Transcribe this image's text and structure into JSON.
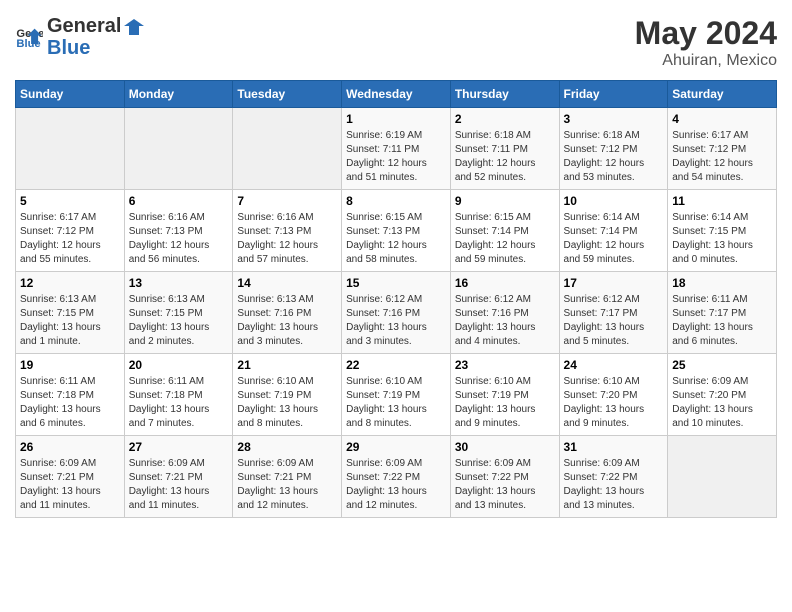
{
  "header": {
    "logo_general": "General",
    "logo_blue": "Blue",
    "title": "May 2024",
    "subtitle": "Ahuiran, Mexico"
  },
  "weekdays": [
    "Sunday",
    "Monday",
    "Tuesday",
    "Wednesday",
    "Thursday",
    "Friday",
    "Saturday"
  ],
  "weeks": [
    [
      {
        "day": "",
        "sunrise": "",
        "sunset": "",
        "daylight": ""
      },
      {
        "day": "",
        "sunrise": "",
        "sunset": "",
        "daylight": ""
      },
      {
        "day": "",
        "sunrise": "",
        "sunset": "",
        "daylight": ""
      },
      {
        "day": "1",
        "sunrise": "Sunrise: 6:19 AM",
        "sunset": "Sunset: 7:11 PM",
        "daylight": "Daylight: 12 hours and 51 minutes."
      },
      {
        "day": "2",
        "sunrise": "Sunrise: 6:18 AM",
        "sunset": "Sunset: 7:11 PM",
        "daylight": "Daylight: 12 hours and 52 minutes."
      },
      {
        "day": "3",
        "sunrise": "Sunrise: 6:18 AM",
        "sunset": "Sunset: 7:12 PM",
        "daylight": "Daylight: 12 hours and 53 minutes."
      },
      {
        "day": "4",
        "sunrise": "Sunrise: 6:17 AM",
        "sunset": "Sunset: 7:12 PM",
        "daylight": "Daylight: 12 hours and 54 minutes."
      }
    ],
    [
      {
        "day": "5",
        "sunrise": "Sunrise: 6:17 AM",
        "sunset": "Sunset: 7:12 PM",
        "daylight": "Daylight: 12 hours and 55 minutes."
      },
      {
        "day": "6",
        "sunrise": "Sunrise: 6:16 AM",
        "sunset": "Sunset: 7:13 PM",
        "daylight": "Daylight: 12 hours and 56 minutes."
      },
      {
        "day": "7",
        "sunrise": "Sunrise: 6:16 AM",
        "sunset": "Sunset: 7:13 PM",
        "daylight": "Daylight: 12 hours and 57 minutes."
      },
      {
        "day": "8",
        "sunrise": "Sunrise: 6:15 AM",
        "sunset": "Sunset: 7:13 PM",
        "daylight": "Daylight: 12 hours and 58 minutes."
      },
      {
        "day": "9",
        "sunrise": "Sunrise: 6:15 AM",
        "sunset": "Sunset: 7:14 PM",
        "daylight": "Daylight: 12 hours and 59 minutes."
      },
      {
        "day": "10",
        "sunrise": "Sunrise: 6:14 AM",
        "sunset": "Sunset: 7:14 PM",
        "daylight": "Daylight: 12 hours and 59 minutes."
      },
      {
        "day": "11",
        "sunrise": "Sunrise: 6:14 AM",
        "sunset": "Sunset: 7:15 PM",
        "daylight": "Daylight: 13 hours and 0 minutes."
      }
    ],
    [
      {
        "day": "12",
        "sunrise": "Sunrise: 6:13 AM",
        "sunset": "Sunset: 7:15 PM",
        "daylight": "Daylight: 13 hours and 1 minute."
      },
      {
        "day": "13",
        "sunrise": "Sunrise: 6:13 AM",
        "sunset": "Sunset: 7:15 PM",
        "daylight": "Daylight: 13 hours and 2 minutes."
      },
      {
        "day": "14",
        "sunrise": "Sunrise: 6:13 AM",
        "sunset": "Sunset: 7:16 PM",
        "daylight": "Daylight: 13 hours and 3 minutes."
      },
      {
        "day": "15",
        "sunrise": "Sunrise: 6:12 AM",
        "sunset": "Sunset: 7:16 PM",
        "daylight": "Daylight: 13 hours and 3 minutes."
      },
      {
        "day": "16",
        "sunrise": "Sunrise: 6:12 AM",
        "sunset": "Sunset: 7:16 PM",
        "daylight": "Daylight: 13 hours and 4 minutes."
      },
      {
        "day": "17",
        "sunrise": "Sunrise: 6:12 AM",
        "sunset": "Sunset: 7:17 PM",
        "daylight": "Daylight: 13 hours and 5 minutes."
      },
      {
        "day": "18",
        "sunrise": "Sunrise: 6:11 AM",
        "sunset": "Sunset: 7:17 PM",
        "daylight": "Daylight: 13 hours and 6 minutes."
      }
    ],
    [
      {
        "day": "19",
        "sunrise": "Sunrise: 6:11 AM",
        "sunset": "Sunset: 7:18 PM",
        "daylight": "Daylight: 13 hours and 6 minutes."
      },
      {
        "day": "20",
        "sunrise": "Sunrise: 6:11 AM",
        "sunset": "Sunset: 7:18 PM",
        "daylight": "Daylight: 13 hours and 7 minutes."
      },
      {
        "day": "21",
        "sunrise": "Sunrise: 6:10 AM",
        "sunset": "Sunset: 7:19 PM",
        "daylight": "Daylight: 13 hours and 8 minutes."
      },
      {
        "day": "22",
        "sunrise": "Sunrise: 6:10 AM",
        "sunset": "Sunset: 7:19 PM",
        "daylight": "Daylight: 13 hours and 8 minutes."
      },
      {
        "day": "23",
        "sunrise": "Sunrise: 6:10 AM",
        "sunset": "Sunset: 7:19 PM",
        "daylight": "Daylight: 13 hours and 9 minutes."
      },
      {
        "day": "24",
        "sunrise": "Sunrise: 6:10 AM",
        "sunset": "Sunset: 7:20 PM",
        "daylight": "Daylight: 13 hours and 9 minutes."
      },
      {
        "day": "25",
        "sunrise": "Sunrise: 6:09 AM",
        "sunset": "Sunset: 7:20 PM",
        "daylight": "Daylight: 13 hours and 10 minutes."
      }
    ],
    [
      {
        "day": "26",
        "sunrise": "Sunrise: 6:09 AM",
        "sunset": "Sunset: 7:21 PM",
        "daylight": "Daylight: 13 hours and 11 minutes."
      },
      {
        "day": "27",
        "sunrise": "Sunrise: 6:09 AM",
        "sunset": "Sunset: 7:21 PM",
        "daylight": "Daylight: 13 hours and 11 minutes."
      },
      {
        "day": "28",
        "sunrise": "Sunrise: 6:09 AM",
        "sunset": "Sunset: 7:21 PM",
        "daylight": "Daylight: 13 hours and 12 minutes."
      },
      {
        "day": "29",
        "sunrise": "Sunrise: 6:09 AM",
        "sunset": "Sunset: 7:22 PM",
        "daylight": "Daylight: 13 hours and 12 minutes."
      },
      {
        "day": "30",
        "sunrise": "Sunrise: 6:09 AM",
        "sunset": "Sunset: 7:22 PM",
        "daylight": "Daylight: 13 hours and 13 minutes."
      },
      {
        "day": "31",
        "sunrise": "Sunrise: 6:09 AM",
        "sunset": "Sunset: 7:22 PM",
        "daylight": "Daylight: 13 hours and 13 minutes."
      },
      {
        "day": "",
        "sunrise": "",
        "sunset": "",
        "daylight": ""
      }
    ]
  ]
}
